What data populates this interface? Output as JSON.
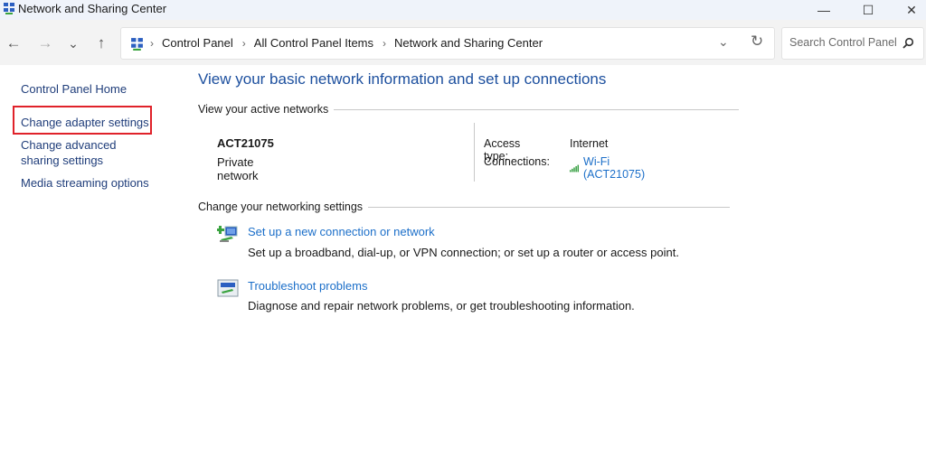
{
  "window": {
    "title": "Network and Sharing Center",
    "app_icon": "network-center-icon",
    "controls": {
      "minimize": "—",
      "maximize": "☐",
      "close": "✕"
    }
  },
  "toolbar": {
    "back": "←",
    "forward": "→",
    "recent": "⌄",
    "up": "↑",
    "breadcrumb": [
      "Control Panel",
      "All Control Panel Items",
      "Network and Sharing Center"
    ],
    "breadcrumb_sep": "›",
    "address_dropdown": "⌄",
    "refresh": "↻",
    "search_placeholder": "Search Control Panel"
  },
  "sidebar": {
    "items": [
      {
        "label": "Control Panel Home"
      },
      {
        "label": "Change adapter settings",
        "highlighted": true
      },
      {
        "label": "Change advanced sharing settings"
      },
      {
        "label": "Media streaming options"
      }
    ],
    "highlight_color": "#e0222a"
  },
  "main": {
    "title": "View your basic network information and set up connections",
    "active_networks": {
      "heading": "View your active networks",
      "network_name": "ACT21075",
      "network_type": "Private network",
      "access_type_label": "Access type:",
      "access_type_value": "Internet",
      "connections_label": "Connections:",
      "connection_link": "Wi-Fi (ACT21075)"
    },
    "settings": {
      "heading": "Change your networking settings",
      "tasks": [
        {
          "icon": "new-connection-icon",
          "link": "Set up a new connection or network",
          "description": "Set up a broadband, dial-up, or VPN connection; or set up a router or access point."
        },
        {
          "icon": "troubleshoot-icon",
          "link": "Troubleshoot problems",
          "description": "Diagnose and repair network problems, or get troubleshooting information."
        }
      ]
    }
  },
  "colors": {
    "title_blue": "#1c4f9e",
    "link_blue": "#1c6fc9",
    "sidebar_link": "#1f3d7a",
    "signal_green": "#2e9b3a"
  }
}
